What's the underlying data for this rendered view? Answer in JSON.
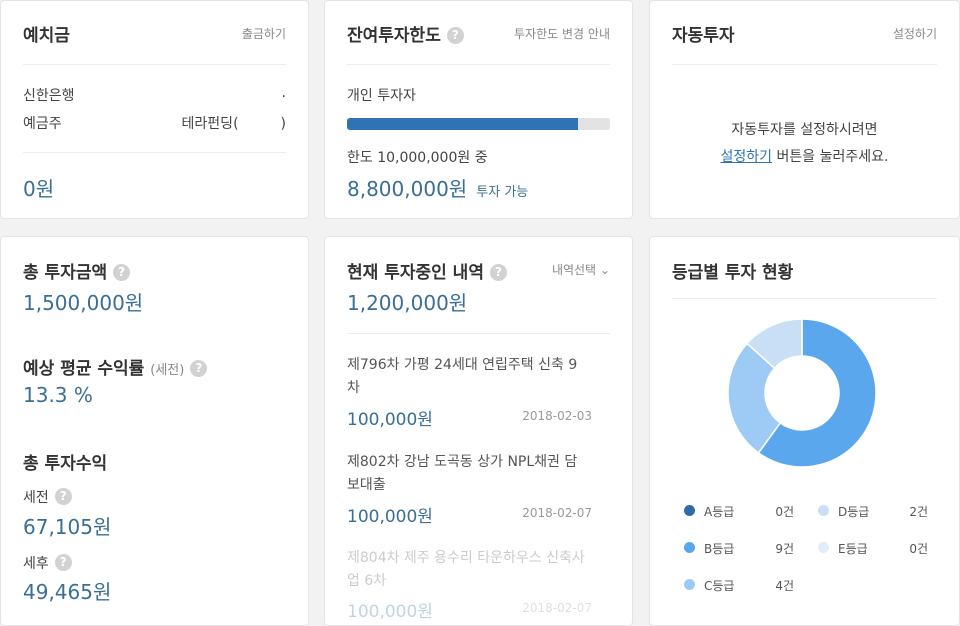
{
  "deposit": {
    "title": "예치금",
    "link": "출금하기",
    "bank_label": "신한은행",
    "bank_value": ".",
    "holder_label": "예금주",
    "holder_value": "테라펀딩(",
    "holder_value_end": ")",
    "amount": "0원"
  },
  "limit": {
    "title": "잔여투자한도",
    "link": "투자한도 변경 안내",
    "investor_type": "개인 투자자",
    "progress": 0.88,
    "limit_text": "한도 10,000,000원 중",
    "available_amount": "8,800,000원",
    "available_label": "투자 가능"
  },
  "auto": {
    "title": "자동투자",
    "link": "설정하기",
    "line1": "자동투자를 설정하시려면",
    "link_inline": "설정하기",
    "line2_rest": " 버튼을 눌러주세요."
  },
  "summary": {
    "total_label": "총 투자금액",
    "total_value": "1,500,000원",
    "rate_label": "예상 평균 수익률",
    "rate_suffix": "(세전)",
    "rate_value": "13.3 %",
    "profit_label": "총 투자수익",
    "pretax_label": "세전",
    "pretax_value": "67,105원",
    "aftertax_label": "세후",
    "aftertax_value": "49,465원"
  },
  "current": {
    "title": "현재 투자중인 내역",
    "select": "내역선택",
    "total": "1,200,000원",
    "items": [
      {
        "title": "제796차 가평 24세대 연립주택 신축 9차",
        "amount": "100,000원",
        "date": "2018-02-03"
      },
      {
        "title": "제802차 강남 도곡동 상가 NPL채권 담보대출",
        "amount": "100,000원",
        "date": "2018-02-07"
      },
      {
        "title": "제804차 제주 용수리 타운하우스 신축사업 6차",
        "amount": "100,000원",
        "date": "2018-02-07"
      }
    ]
  },
  "grade": {
    "title": "등급별 투자 현황",
    "legend": [
      {
        "name": "A등급",
        "count": "0건",
        "color": "#2f6aa8"
      },
      {
        "name": "D등급",
        "count": "2건",
        "color": "#c8dff5"
      },
      {
        "name": "B등급",
        "count": "9건",
        "color": "#5aa7ed"
      },
      {
        "name": "E등급",
        "count": "0건",
        "color": "#e1edf9"
      },
      {
        "name": "C등급",
        "count": "4건",
        "color": "#9ecbf5"
      }
    ],
    "chart_data": {
      "type": "pie",
      "categories": [
        "A등급",
        "B등급",
        "C등급",
        "D등급",
        "E등급"
      ],
      "values": [
        0,
        9,
        4,
        2,
        0
      ]
    }
  }
}
